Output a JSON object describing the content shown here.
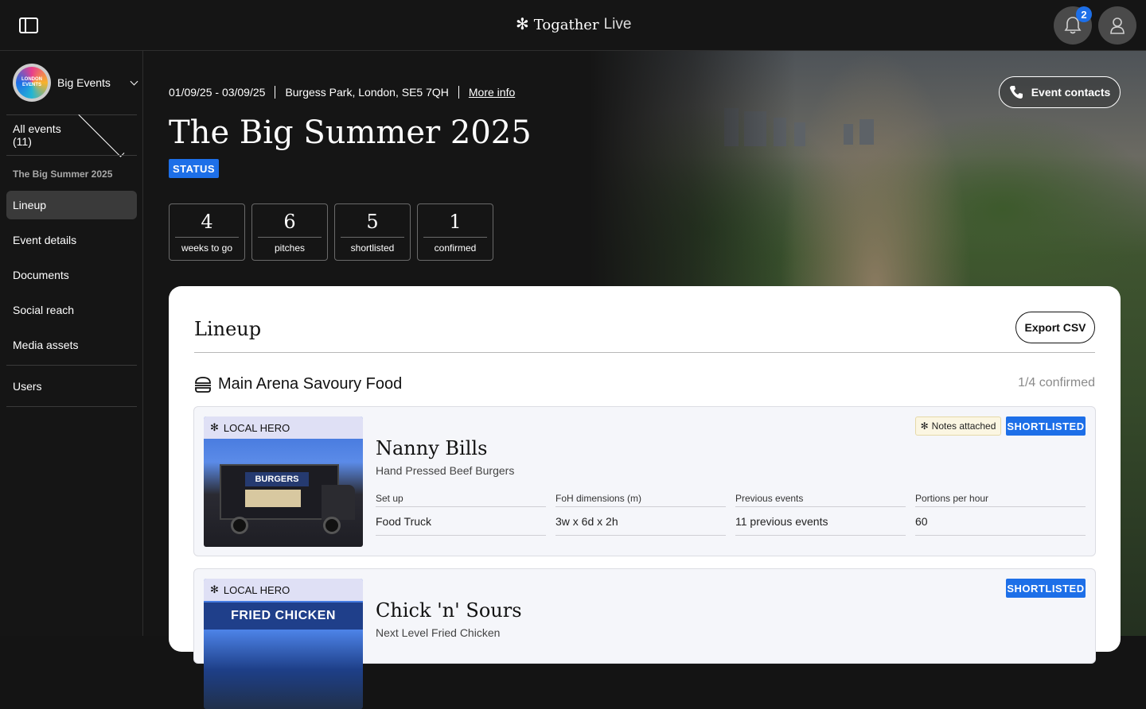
{
  "brand": {
    "name_strong": "Togather",
    "name_light": "Live"
  },
  "notifications": {
    "count": "2"
  },
  "sidebar": {
    "org": {
      "name": "Big Events",
      "logo_text": "LONDON EVENTS"
    },
    "all_events": "All events (11)",
    "section": "The Big Summer 2025",
    "items": [
      {
        "label": "Lineup",
        "active": true
      },
      {
        "label": "Event details"
      },
      {
        "label": "Documents"
      },
      {
        "label": "Social reach"
      },
      {
        "label": "Media assets"
      },
      {
        "label": "Users"
      }
    ]
  },
  "event": {
    "dates": "01/09/25 - 03/09/25",
    "location": "Burgess Park, London, SE5 7QH",
    "more_info": "More info",
    "contacts_label": "Event contacts",
    "title": "The Big Summer 2025",
    "status": "STATUS",
    "stats": [
      {
        "num": "4",
        "label": "weeks to go"
      },
      {
        "num": "6",
        "label": "pitches"
      },
      {
        "num": "5",
        "label": "shortlisted"
      },
      {
        "num": "1",
        "label": "confirmed"
      }
    ]
  },
  "lineup": {
    "title": "Lineup",
    "export_label": "Export CSV",
    "section_title": "Main Arena Savoury Food",
    "section_count": "1/4 confirmed",
    "items": [
      {
        "tag": "LOCAL HERO",
        "name": "Nanny Bills",
        "desc": "Hand Pressed Beef Burgers",
        "notes": "Notes attached",
        "status": "SHORTLISTED",
        "image_sign": "BURGERS",
        "attrs": [
          {
            "label": "Set up",
            "value": "Food Truck"
          },
          {
            "label": "FoH dimensions (m)",
            "value": "3w x 6d x 2h"
          },
          {
            "label": "Previous events",
            "value": "11 previous events"
          },
          {
            "label": "Portions per hour",
            "value": "60"
          }
        ]
      },
      {
        "tag": "LOCAL HERO",
        "name": "Chick 'n' Sours",
        "desc": "Next Level Fried Chicken",
        "status": "SHORTLISTED",
        "image_sign": "FRIED CHICKEN"
      }
    ]
  },
  "colors": {
    "accent": "#1d6fe8",
    "background": "#151515",
    "tag_bg": "#dfe0f5",
    "notes_bg": "#fbf6e2"
  }
}
